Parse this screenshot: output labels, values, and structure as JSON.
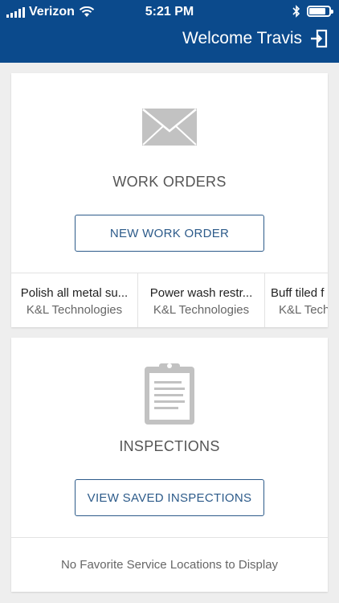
{
  "status_bar": {
    "carrier": "Verizon",
    "time": "5:21 PM",
    "battery_level": 0.85
  },
  "header": {
    "welcome": "Welcome Travis",
    "bg_color": "#0b4a8c",
    "logout_icon": "logout-icon"
  },
  "work_orders": {
    "icon": "envelope-icon",
    "title": "WORK ORDERS",
    "button": "NEW WORK ORDER",
    "items": [
      {
        "title": "Polish all metal su...",
        "company": "K&L Technologies"
      },
      {
        "title": "Power wash restr...",
        "company": "K&L Technologies"
      },
      {
        "title": "Buff tiled f",
        "company": "K&L Tech"
      }
    ]
  },
  "inspections": {
    "icon": "clipboard-icon",
    "title": "INSPECTIONS",
    "button": "VIEW SAVED INSPECTIONS",
    "empty_message": "No Favorite Service Locations to Display"
  },
  "colors": {
    "accent": "#2d5b8a",
    "icon_gray": "#c2c2c2"
  }
}
